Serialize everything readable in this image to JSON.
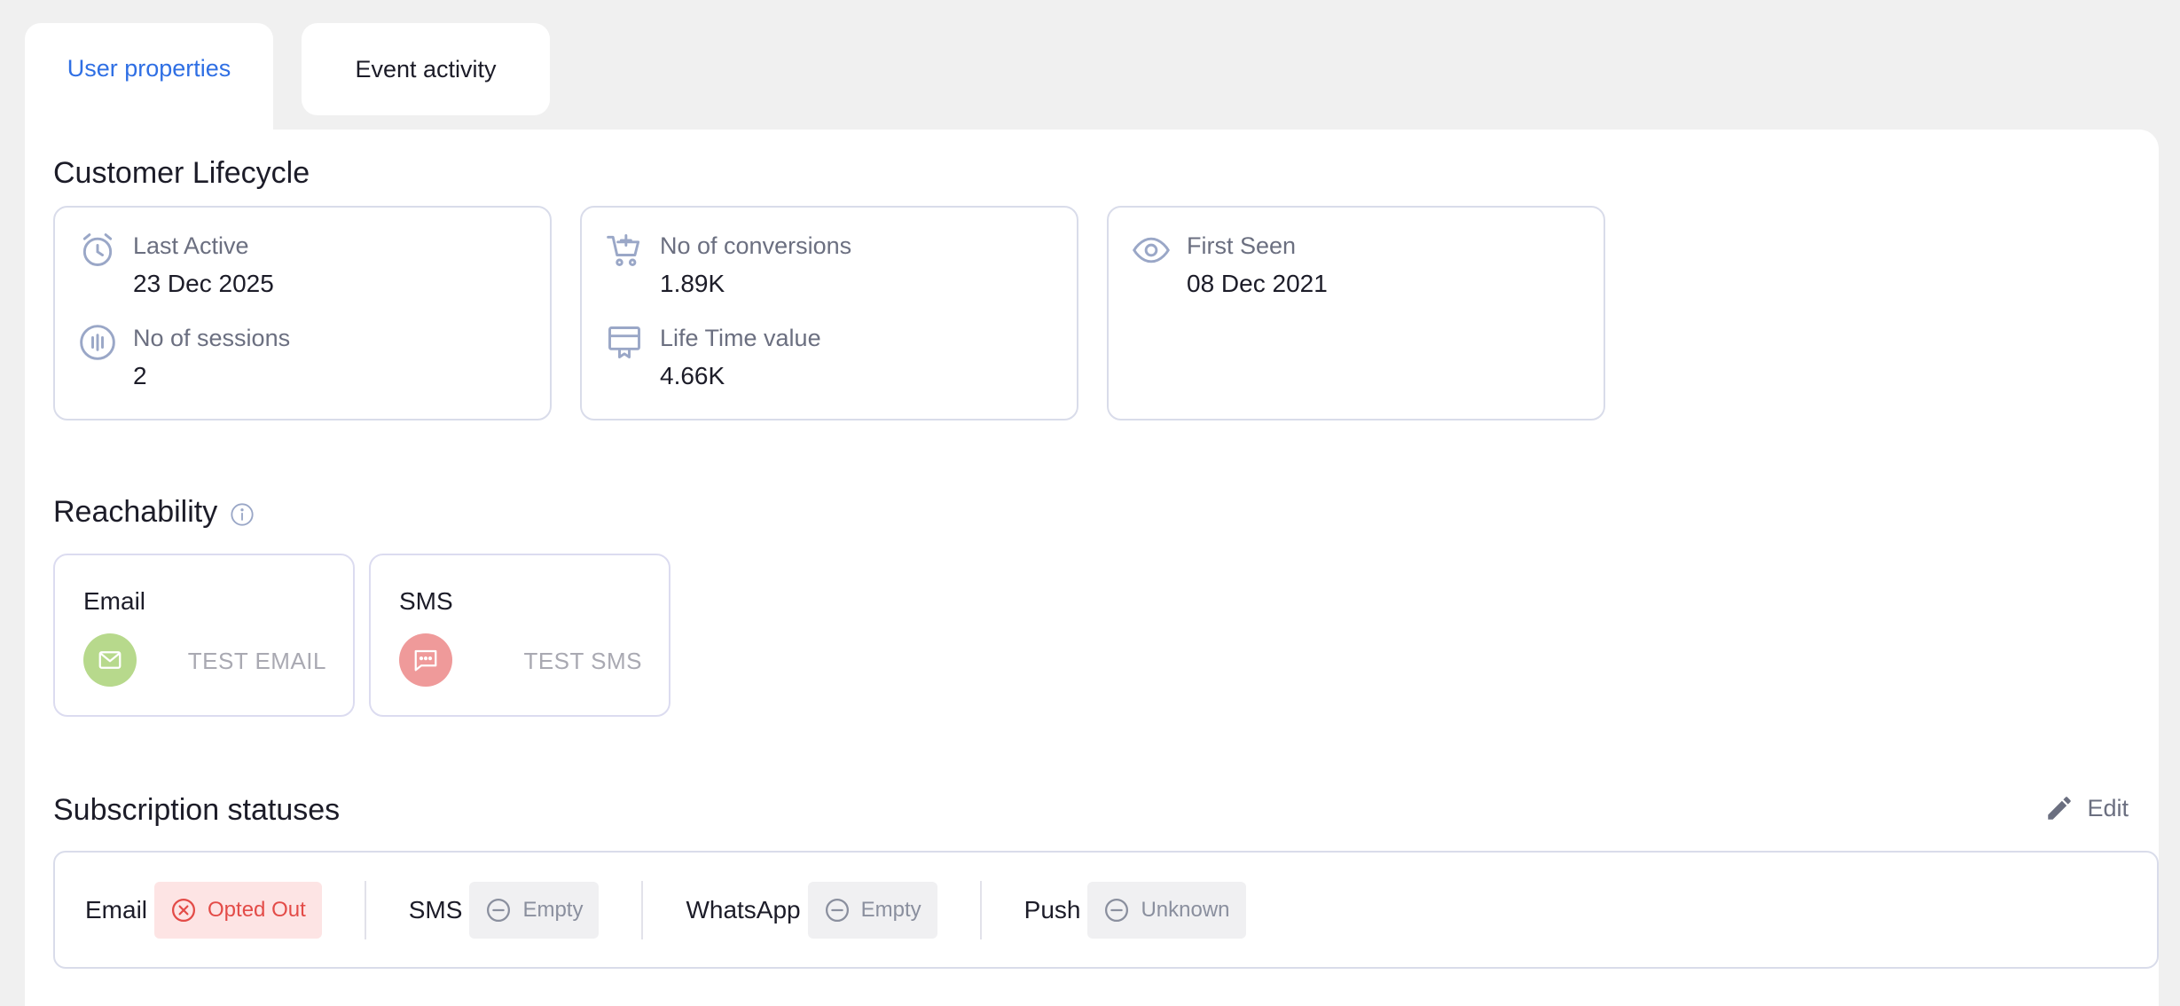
{
  "tabs": {
    "user_properties": "User properties",
    "event_activity": "Event activity"
  },
  "lifecycle": {
    "title": "Customer Lifecycle",
    "last_active": {
      "label": "Last Active",
      "value": "23 Dec 2025",
      "icon": "alarm-clock-icon"
    },
    "sessions": {
      "label": "No of sessions",
      "value": "2",
      "icon": "signal-icon"
    },
    "conversions": {
      "label": "No of conversions",
      "value": "1.89K",
      "icon": "cart-add-icon"
    },
    "ltv": {
      "label": "Life Time value",
      "value": "4.66K",
      "icon": "card-icon"
    },
    "first_seen": {
      "label": "First Seen",
      "value": "08 Dec 2021",
      "icon": "eye-icon"
    }
  },
  "reachability": {
    "title": "Reachability",
    "email": {
      "label": "Email",
      "value": "TEST EMAIL",
      "color": "#b7d98c",
      "icon": "mail-icon"
    },
    "sms": {
      "label": "SMS",
      "value": "TEST SMS",
      "color": "#ef9a9a",
      "icon": "chat-icon"
    }
  },
  "subscriptions": {
    "title": "Subscription statuses",
    "edit_label": "Edit",
    "items": [
      {
        "name": "Email",
        "status": "Opted Out"
      },
      {
        "name": "SMS",
        "status": "Empty"
      },
      {
        "name": "WhatsApp",
        "status": "Empty"
      },
      {
        "name": "Push",
        "status": "Unknown"
      }
    ]
  },
  "colors": {
    "accent": "#2f6fe4",
    "opted_out": "#e34b47",
    "icon_muted": "#9aa7c7"
  }
}
